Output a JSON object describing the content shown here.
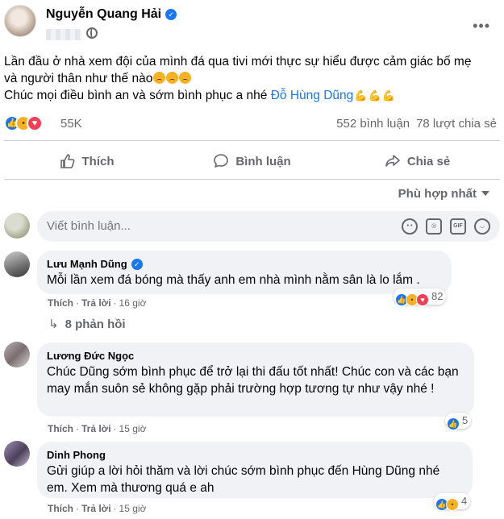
{
  "post": {
    "author": "Nguyễn Quang Hải",
    "text_line1": "Lần đầu ở nhà xem đội của mình đá qua tivi mới thực sự hiểu được cảm giác bố mẹ",
    "text_line2": "và người thân như thế nào",
    "text_line3_prefix": "Chúc mọi điều bình an và sớm bình phục a nhé",
    "mention": "Đỗ Hùng Dũng",
    "reaction_count": "55K",
    "comments_count": "552 bình luận",
    "shares_count": "78 lượt chia sẻ"
  },
  "actions": {
    "like": "Thích",
    "comment": "Bình luận",
    "share": "Chia sẻ"
  },
  "sort_label": "Phù hợp nhất",
  "compose": {
    "placeholder": "Viết bình luận..."
  },
  "comments": [
    {
      "author": "Lưu Mạnh Dũng",
      "text": "Mỗi lần xem đá bóng mà thấy anh em nhà mình nằm sân là lo lắm .",
      "like": "Thích",
      "reply": "Trả lời",
      "time": "16 giờ",
      "reactions": "82",
      "replies": "8 phản hồi"
    },
    {
      "author": "Lương Đức Ngọc",
      "text": "Chúc Dũng sớm bình phục để trở lại thi đấu tốt nhất! Chúc con và các bạn may mắn suôn sẻ không gặp phải trường hợp tương tự như vậy nhé !",
      "like": "Thích",
      "reply": "Trả lời",
      "time": "15 giờ",
      "reactions": "5"
    },
    {
      "author": "Dinh Phong",
      "text": "Gửi giúp a lời hỏi thăm và lời chúc sớm bình phục đến Hùng Dũng nhé em. Xem mà thương quá e ah",
      "like": "Thích",
      "reply": "Trả lời",
      "time": "15 giờ",
      "reactions": "4"
    }
  ],
  "colors": {
    "link": "#1877f2",
    "secondary_text": "#65676b",
    "bubble": "#f0f2f5"
  }
}
